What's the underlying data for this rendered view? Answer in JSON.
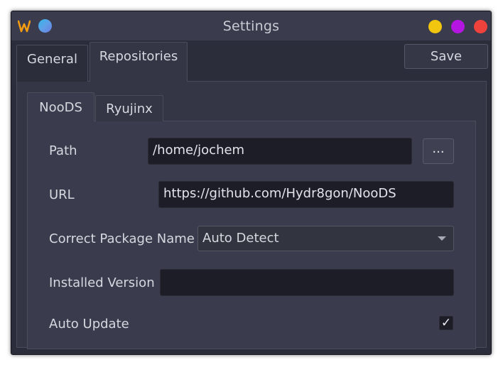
{
  "window": {
    "title": "Settings",
    "logo_icon": "w-logo-icon",
    "controls": [
      "minimize-button",
      "maximize-button",
      "close-button"
    ],
    "colors": {
      "minimize": "#f2c50e",
      "maximize": "#b515e0",
      "close": "#f0423c"
    }
  },
  "top_tabs": [
    {
      "label": "General",
      "active": false
    },
    {
      "label": "Repositories",
      "active": true
    }
  ],
  "save_label": "Save",
  "repo_tabs": [
    {
      "label": "NooDS",
      "active": true
    },
    {
      "label": "Ryujinx",
      "active": false
    }
  ],
  "form": {
    "path_label": "Path",
    "path_value": "/home/jochem",
    "browse_label": "...",
    "url_label": "URL",
    "url_value": "https://github.com/Hydr8gon/NooDS",
    "package_label": "Correct Package Name",
    "package_value": "Auto Detect",
    "version_label": "Installed Version",
    "version_value": "",
    "auto_update_label": "Auto Update",
    "auto_update_checked": true,
    "check_glyph": "✓"
  }
}
